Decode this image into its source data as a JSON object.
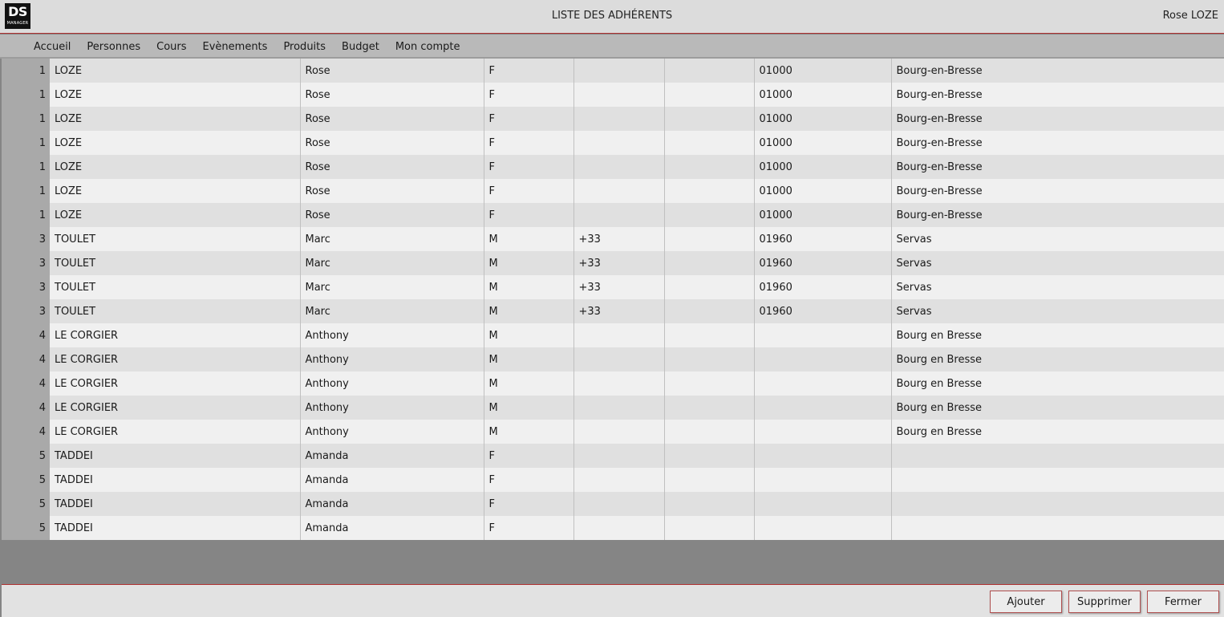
{
  "header": {
    "logo_text": "DS",
    "logo_subtext": "MANAGER",
    "title": "LISTE DES ADHÉRENTS",
    "user": "Rose LOZE"
  },
  "nav": {
    "items": [
      {
        "label": "Accueil"
      },
      {
        "label": "Personnes"
      },
      {
        "label": "Cours"
      },
      {
        "label": "Evènements"
      },
      {
        "label": "Produits"
      },
      {
        "label": "Budget"
      },
      {
        "label": "Mon compte"
      }
    ]
  },
  "table": {
    "rows": [
      [
        "1",
        "LOZE",
        "Rose",
        "F",
        "",
        "",
        "01000",
        "Bourg-en-Bresse"
      ],
      [
        "1",
        "LOZE",
        "Rose",
        "F",
        "",
        "",
        "01000",
        "Bourg-en-Bresse"
      ],
      [
        "1",
        "LOZE",
        "Rose",
        "F",
        "",
        "",
        "01000",
        "Bourg-en-Bresse"
      ],
      [
        "1",
        "LOZE",
        "Rose",
        "F",
        "",
        "",
        "01000",
        "Bourg-en-Bresse"
      ],
      [
        "1",
        "LOZE",
        "Rose",
        "F",
        "",
        "",
        "01000",
        "Bourg-en-Bresse"
      ],
      [
        "1",
        "LOZE",
        "Rose",
        "F",
        "",
        "",
        "01000",
        "Bourg-en-Bresse"
      ],
      [
        "1",
        "LOZE",
        "Rose",
        "F",
        "",
        "",
        "01000",
        "Bourg-en-Bresse"
      ],
      [
        "3",
        "TOULET",
        "Marc",
        "M",
        "+33",
        "",
        "01960",
        "Servas"
      ],
      [
        "3",
        "TOULET",
        "Marc",
        "M",
        "+33",
        "",
        "01960",
        "Servas"
      ],
      [
        "3",
        "TOULET",
        "Marc",
        "M",
        "+33",
        "",
        "01960",
        "Servas"
      ],
      [
        "3",
        "TOULET",
        "Marc",
        "M",
        "+33",
        "",
        "01960",
        "Servas"
      ],
      [
        "4",
        "LE CORGIER",
        "Anthony",
        "M",
        "",
        "",
        "",
        "Bourg en Bresse"
      ],
      [
        "4",
        "LE CORGIER",
        "Anthony",
        "M",
        "",
        "",
        "",
        "Bourg en Bresse"
      ],
      [
        "4",
        "LE CORGIER",
        "Anthony",
        "M",
        "",
        "",
        "",
        "Bourg en Bresse"
      ],
      [
        "4",
        "LE CORGIER",
        "Anthony",
        "M",
        "",
        "",
        "",
        "Bourg en Bresse"
      ],
      [
        "4",
        "LE CORGIER",
        "Anthony",
        "M",
        "",
        "",
        "",
        "Bourg en Bresse"
      ],
      [
        "5",
        "TADDEI",
        "Amanda",
        "F",
        "",
        "",
        "",
        ""
      ],
      [
        "5",
        "TADDEI",
        "Amanda",
        "F",
        "",
        "",
        "",
        ""
      ],
      [
        "5",
        "TADDEI",
        "Amanda",
        "F",
        "",
        "",
        "",
        ""
      ],
      [
        "5",
        "TADDEI",
        "Amanda",
        "F",
        "",
        "",
        "",
        ""
      ]
    ]
  },
  "footer": {
    "add_label": "Ajouter",
    "delete_label": "Supprimer",
    "close_label": "Fermer"
  }
}
